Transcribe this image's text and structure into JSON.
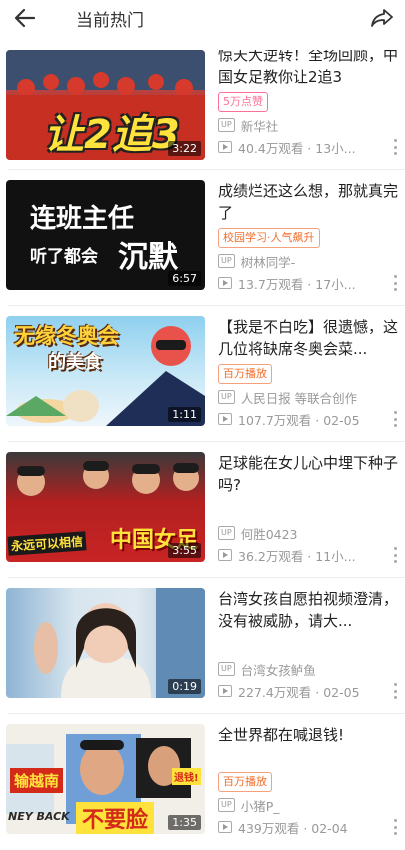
{
  "header": {
    "title": "当前热门",
    "back_icon": "arrow-left-icon",
    "share_icon": "share-icon"
  },
  "colors": {
    "accent_pink": "#fb7299",
    "accent_orange": "#f26d2b",
    "meta_gray": "#999999"
  },
  "items": [
    {
      "title": "惊天大逆转！全场回顾，中国女足教你让2追3",
      "thumb_text": "让2追3",
      "duration": "3:22",
      "badge": "5万点赞",
      "up": "新华社",
      "views": "40.4万观看 · 13小..."
    },
    {
      "title": "成绩烂还这么想，那就真完了",
      "thumb_text_1": "连班主任",
      "thumb_text_2": "听了都会",
      "thumb_text_3": "沉默",
      "duration": "6:57",
      "badge": "校园学习·人气飙升",
      "up": "树林同学-",
      "views": "13.7万观看 · 17小..."
    },
    {
      "title": "【我是不白吃】很遗憾，这几位将缺席冬奥会菜...",
      "thumb_text_1": "无缘冬奥会",
      "thumb_text_2": "的美食",
      "duration": "1:11",
      "badge": "百万播放",
      "up": "人民日报 等联合创作",
      "views": "107.7万观看 · 02-05"
    },
    {
      "title": "足球能在女儿心中埋下种子吗?",
      "thumb_text_1": "永远可以相信",
      "thumb_text_2": "中国女足",
      "duration": "3:55",
      "badge": "",
      "up": "何胜0423",
      "views": "36.2万观看 · 11小..."
    },
    {
      "title": "台湾女孩自愿拍视频澄清，没有被威胁，请大...",
      "duration": "0:19",
      "badge": "",
      "up": "台湾女孩鲈鱼",
      "views": "227.4万观看 · 02-05"
    },
    {
      "title": "全世界都在喊退钱!",
      "thumb_text_1": "输越南",
      "thumb_text_2": "不要脸",
      "thumb_text_3": "退钱!",
      "thumb_text_4": "NEY BACK",
      "duration": "1:35",
      "badge": "百万播放",
      "up": "小猪P_",
      "views": "439万观看 · 02-04"
    }
  ]
}
